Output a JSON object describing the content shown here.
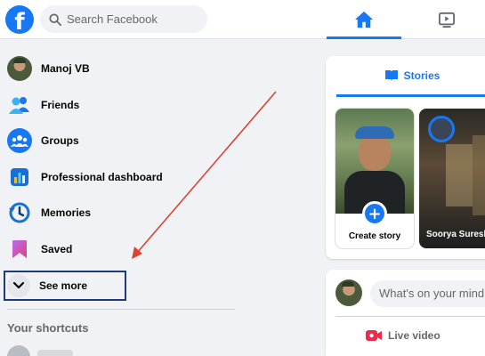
{
  "topbar": {
    "logo": "f",
    "search_placeholder": "Search Facebook",
    "nav": [
      {
        "icon": "home-icon",
        "active": true
      },
      {
        "icon": "watch-icon",
        "active": false
      }
    ]
  },
  "sidebar": {
    "items": [
      {
        "label": "Manoj VB",
        "icon": "avatar"
      },
      {
        "label": "Friends",
        "icon": "friends-icon"
      },
      {
        "label": "Groups",
        "icon": "groups-icon"
      },
      {
        "label": "Professional dashboard",
        "icon": "dashboard-icon"
      },
      {
        "label": "Memories",
        "icon": "memories-icon"
      },
      {
        "label": "Saved",
        "icon": "saved-icon"
      }
    ],
    "see_more_label": "See more",
    "shortcuts_title": "Your shortcuts"
  },
  "stories": {
    "tab_label": "Stories",
    "create_label": "Create story",
    "friend_name": "Soorya Suresh"
  },
  "composer": {
    "placeholder": "What's on your mind, Manoj?",
    "live_label": "Live video"
  },
  "colors": {
    "brand": "#1877f2",
    "annotation_arrow": "#d9442e",
    "highlight_box": "#1d3a7a"
  }
}
